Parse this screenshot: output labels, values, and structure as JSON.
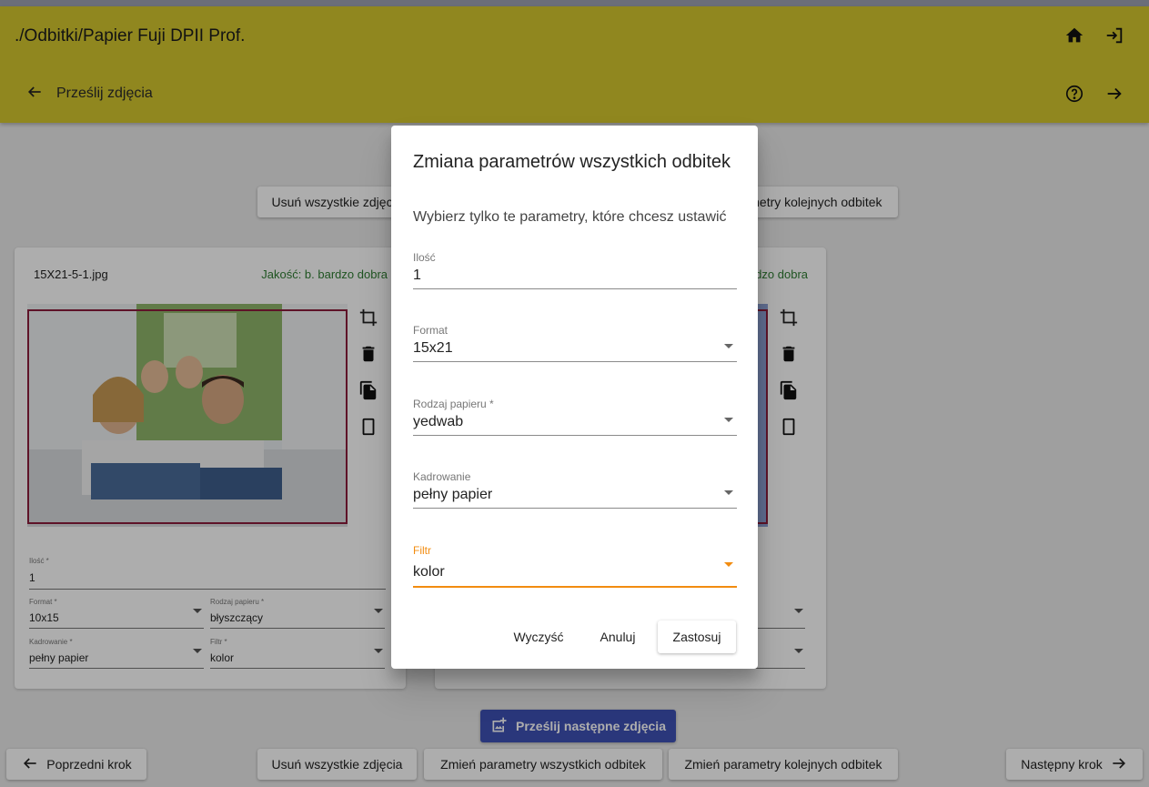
{
  "header": {
    "title": "./Odbitki/Papier Fuji DPII Prof.",
    "back_label": "Prześlij zdjęcia"
  },
  "colors": {
    "header": "#d4c72f",
    "accent": "#f28c10",
    "primary": "#3f51b5",
    "quality": "#2e7d32"
  },
  "toolbar_top": {
    "delete_all": "Usuń wszystkie zdjęcia",
    "change_next": "Zmień parametry kolejnych odbitek"
  },
  "cards": [
    {
      "filename": "15X21-5-1.jpg",
      "quality": "Jakość: b. bardzo dobra",
      "ilosc_label": "Ilość *",
      "ilosc": "1",
      "format_label": "Format *",
      "format": "10x15",
      "paper_label": "Rodzaj papieru *",
      "paper": "błyszczący",
      "crop_label": "Kadrowanie *",
      "crop": "pełny papier",
      "filter_label": "Filtr *",
      "filter": "kolor"
    },
    {
      "quality": "Jakość: b. bardzo dobra"
    }
  ],
  "upload_label": "Prześlij następne zdjęcia",
  "bottom": {
    "prev": "Poprzedni krok",
    "delete_all": "Usuń wszystkie zdjęcia",
    "change_all": "Zmień parametry wszystkich odbitek",
    "change_next": "Zmień parametry kolejnych odbitek",
    "next": "Następny krok"
  },
  "dialog": {
    "title": "Zmiana parametrów wszystkich odbitek",
    "subtitle": "Wybierz tylko te parametry, które chcesz ustawić",
    "fields": [
      {
        "label": "Ilość",
        "value": "1"
      },
      {
        "label": "Format",
        "value": "15x21"
      },
      {
        "label": "Rodzaj papieru *",
        "value": "yedwab"
      },
      {
        "label": "Kadrowanie",
        "value": "pełny papier"
      },
      {
        "label": "Filtr",
        "value": "kolor"
      }
    ],
    "clear": "Wyczyść",
    "cancel": "Anuluj",
    "apply": "Zastosuj"
  }
}
